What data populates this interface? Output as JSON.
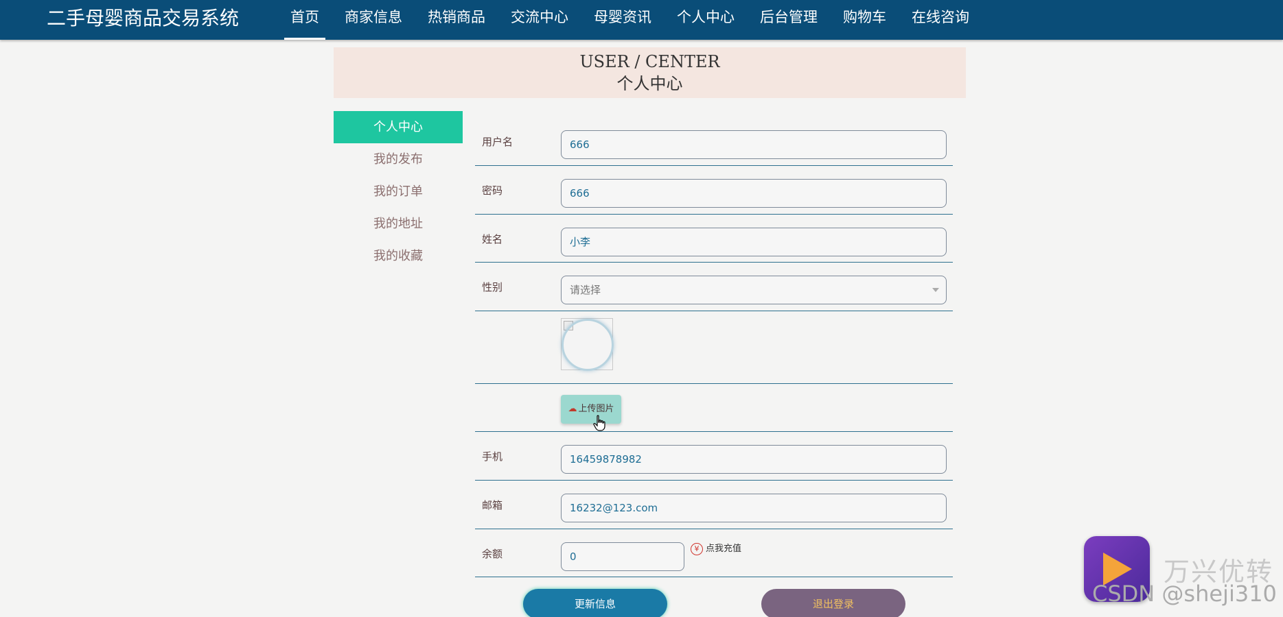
{
  "header": {
    "site_title": "二手母婴商品交易系统",
    "nav": [
      {
        "label": "首页",
        "active": true
      },
      {
        "label": "商家信息",
        "active": false
      },
      {
        "label": "热销商品",
        "active": false
      },
      {
        "label": "交流中心",
        "active": false
      },
      {
        "label": "母婴资讯",
        "active": false
      },
      {
        "label": "个人中心",
        "active": false
      },
      {
        "label": "后台管理",
        "active": false
      },
      {
        "label": "购物车",
        "active": false
      },
      {
        "label": "在线咨询",
        "active": false
      }
    ]
  },
  "banner": {
    "title_en": "USER / CENTER",
    "title_cn": "个人中心"
  },
  "sidebar": {
    "items": [
      {
        "label": "个人中心",
        "active": true
      },
      {
        "label": "我的发布",
        "active": false
      },
      {
        "label": "我的订单",
        "active": false
      },
      {
        "label": "我的地址",
        "active": false
      },
      {
        "label": "我的收藏",
        "active": false
      }
    ]
  },
  "form": {
    "username": {
      "label": "用户名",
      "value": "666"
    },
    "password": {
      "label": "密码",
      "value": "666"
    },
    "name": {
      "label": "姓名",
      "value": "小李"
    },
    "gender": {
      "label": "性别",
      "placeholder": "请选择"
    },
    "upload": {
      "label": "上传图片",
      "icon": "cloud-upload-icon"
    },
    "phone": {
      "label": "手机",
      "value": "16459878982"
    },
    "email": {
      "label": "邮箱",
      "value": "16232@123.com"
    },
    "balance": {
      "label": "余额",
      "value": "0",
      "recharge_label": "点我充值",
      "recharge_icon": "¥"
    }
  },
  "buttons": {
    "update_label": "更新信息",
    "logout_label": "退出登录"
  },
  "watermark": {
    "brand": "万兴优转",
    "csdn": "CSDN @sheji310"
  },
  "colors": {
    "header_bg": "#0a4d78",
    "accent_green": "#1ec6a0",
    "banner_bg": "#f4e6e0",
    "update_button": "#1a7aa6",
    "logout_button": "#7a6480"
  }
}
